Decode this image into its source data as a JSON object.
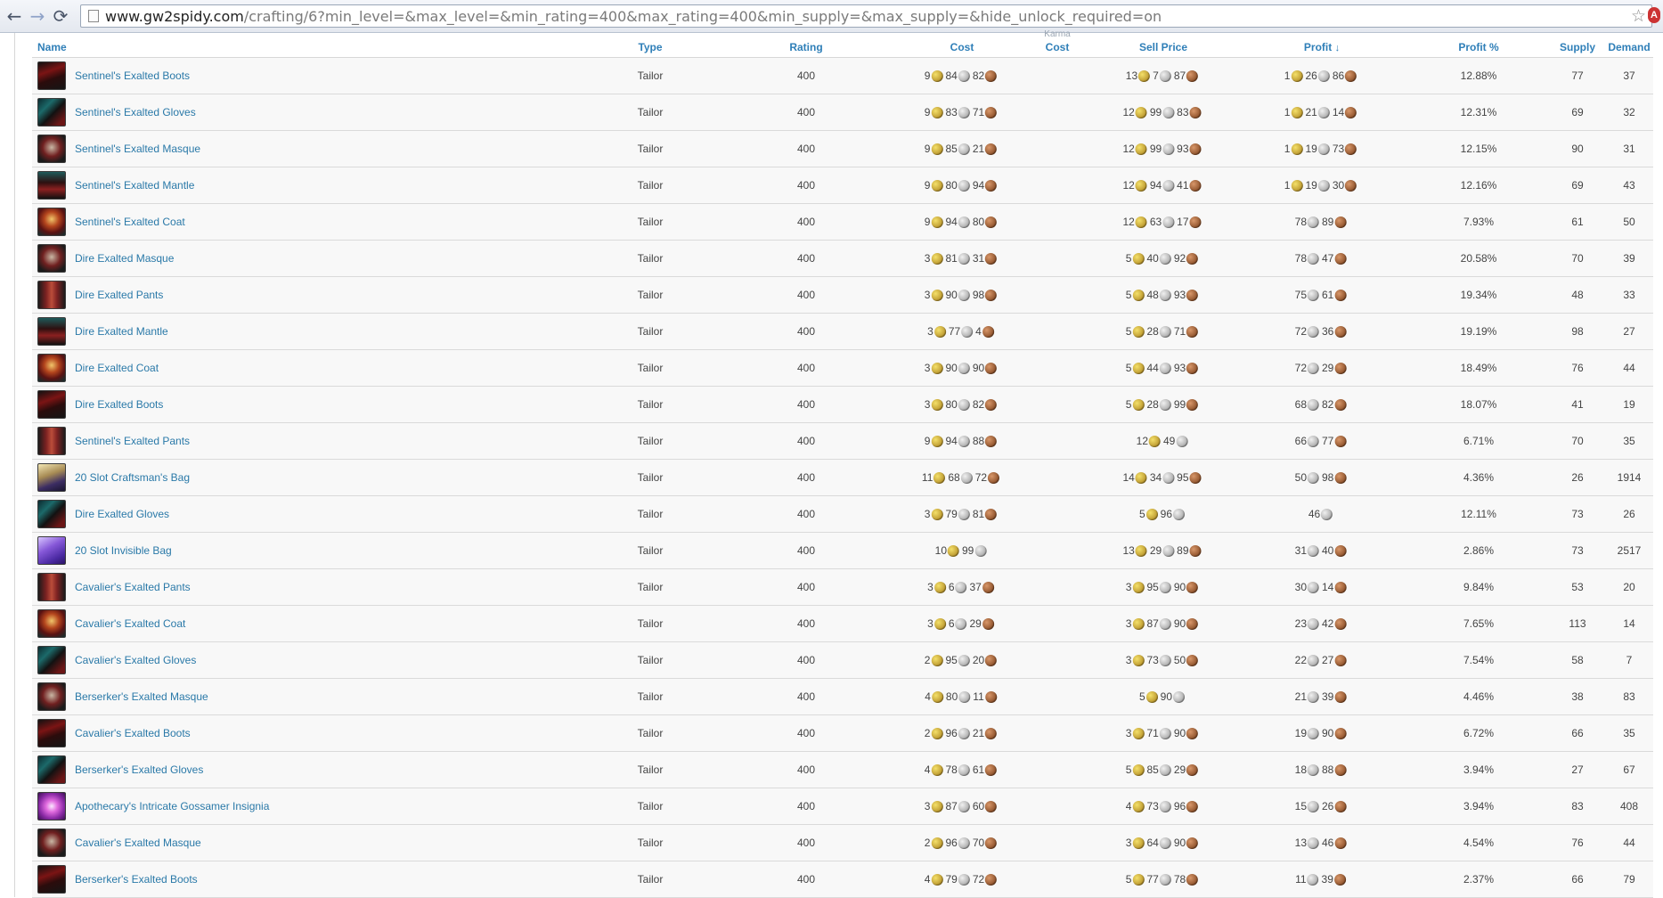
{
  "browser": {
    "back_glyph": "←",
    "forward_glyph": "→",
    "reload_glyph": "⟳",
    "url_domain": "www.gw2spidy.com",
    "url_rest": "/crafting/6?min_level=&max_level=&min_rating=400&max_rating=400&min_supply=&max_supply=&hide_unlock_required=on",
    "star_glyph": "☆",
    "extension_label": "A"
  },
  "table": {
    "headers": {
      "name": "Name",
      "type": "Type",
      "rating": "Rating",
      "cost": "Cost",
      "karma_top": "Karma",
      "karma_cost": "Cost",
      "sell_price": "Sell Price",
      "profit": "Profit",
      "profit_sort_arrow": "↓",
      "profit_pct": "Profit %",
      "supply": "Supply",
      "demand": "Demand"
    },
    "rows": [
      {
        "name": "Sentinel's Exalted Boots",
        "icon": "boots",
        "type": "Tailor",
        "rating": "400",
        "cost": [
          "9",
          "84",
          "82"
        ],
        "sell": [
          "13",
          "7",
          "87"
        ],
        "profit": [
          "1",
          "26",
          "86"
        ],
        "profit_pct": "12.88%",
        "supply": "77",
        "demand": "37"
      },
      {
        "name": "Sentinel's Exalted Gloves",
        "icon": "gloves",
        "type": "Tailor",
        "rating": "400",
        "cost": [
          "9",
          "83",
          "71"
        ],
        "sell": [
          "12",
          "99",
          "83"
        ],
        "profit": [
          "1",
          "21",
          "14"
        ],
        "profit_pct": "12.31%",
        "supply": "69",
        "demand": "32"
      },
      {
        "name": "Sentinel's Exalted Masque",
        "icon": "masque",
        "type": "Tailor",
        "rating": "400",
        "cost": [
          "9",
          "85",
          "21"
        ],
        "sell": [
          "12",
          "99",
          "93"
        ],
        "profit": [
          "1",
          "19",
          "73"
        ],
        "profit_pct": "12.15%",
        "supply": "90",
        "demand": "31"
      },
      {
        "name": "Sentinel's Exalted Mantle",
        "icon": "mantle",
        "type": "Tailor",
        "rating": "400",
        "cost": [
          "9",
          "80",
          "94"
        ],
        "sell": [
          "12",
          "94",
          "41"
        ],
        "profit": [
          "1",
          "19",
          "30"
        ],
        "profit_pct": "12.16%",
        "supply": "69",
        "demand": "43"
      },
      {
        "name": "Sentinel's Exalted Coat",
        "icon": "coat",
        "type": "Tailor",
        "rating": "400",
        "cost": [
          "9",
          "94",
          "80"
        ],
        "sell": [
          "12",
          "63",
          "17"
        ],
        "profit": [
          "",
          "78",
          "89"
        ],
        "profit_pct": "7.93%",
        "supply": "61",
        "demand": "50"
      },
      {
        "name": "Dire Exalted Masque",
        "icon": "masque",
        "type": "Tailor",
        "rating": "400",
        "cost": [
          "3",
          "81",
          "31"
        ],
        "sell": [
          "5",
          "40",
          "92"
        ],
        "profit": [
          "",
          "78",
          "47"
        ],
        "profit_pct": "20.58%",
        "supply": "70",
        "demand": "39"
      },
      {
        "name": "Dire Exalted Pants",
        "icon": "pants",
        "type": "Tailor",
        "rating": "400",
        "cost": [
          "3",
          "90",
          "98"
        ],
        "sell": [
          "5",
          "48",
          "93"
        ],
        "profit": [
          "",
          "75",
          "61"
        ],
        "profit_pct": "19.34%",
        "supply": "48",
        "demand": "33"
      },
      {
        "name": "Dire Exalted Mantle",
        "icon": "mantle",
        "type": "Tailor",
        "rating": "400",
        "cost": [
          "3",
          "77",
          "4"
        ],
        "sell": [
          "5",
          "28",
          "71"
        ],
        "profit": [
          "",
          "72",
          "36"
        ],
        "profit_pct": "19.19%",
        "supply": "98",
        "demand": "27"
      },
      {
        "name": "Dire Exalted Coat",
        "icon": "coat",
        "type": "Tailor",
        "rating": "400",
        "cost": [
          "3",
          "90",
          "90"
        ],
        "sell": [
          "5",
          "44",
          "93"
        ],
        "profit": [
          "",
          "72",
          "29"
        ],
        "profit_pct": "18.49%",
        "supply": "76",
        "demand": "44"
      },
      {
        "name": "Dire Exalted Boots",
        "icon": "boots",
        "type": "Tailor",
        "rating": "400",
        "cost": [
          "3",
          "80",
          "82"
        ],
        "sell": [
          "5",
          "28",
          "99"
        ],
        "profit": [
          "",
          "68",
          "82"
        ],
        "profit_pct": "18.07%",
        "supply": "41",
        "demand": "19"
      },
      {
        "name": "Sentinel's Exalted Pants",
        "icon": "pants",
        "type": "Tailor",
        "rating": "400",
        "cost": [
          "9",
          "94",
          "88"
        ],
        "sell": [
          "12",
          "49",
          ""
        ],
        "profit": [
          "",
          "66",
          "77"
        ],
        "profit_pct": "6.71%",
        "supply": "70",
        "demand": "35"
      },
      {
        "name": "20 Slot Craftsman's Bag",
        "icon": "bag",
        "type": "Tailor",
        "rating": "400",
        "cost": [
          "11",
          "68",
          "72"
        ],
        "sell": [
          "14",
          "34",
          "95"
        ],
        "profit": [
          "",
          "50",
          "98"
        ],
        "profit_pct": "4.36%",
        "supply": "26",
        "demand": "1914"
      },
      {
        "name": "Dire Exalted Gloves",
        "icon": "gloves",
        "type": "Tailor",
        "rating": "400",
        "cost": [
          "3",
          "79",
          "81"
        ],
        "sell": [
          "5",
          "96",
          ""
        ],
        "profit": [
          "",
          "46",
          ""
        ],
        "profit_pct": "12.11%",
        "supply": "73",
        "demand": "26"
      },
      {
        "name": "20 Slot Invisible Bag",
        "icon": "invbag",
        "type": "Tailor",
        "rating": "400",
        "cost": [
          "10",
          "99",
          ""
        ],
        "sell": [
          "13",
          "29",
          "89"
        ],
        "profit": [
          "",
          "31",
          "40"
        ],
        "profit_pct": "2.86%",
        "supply": "73",
        "demand": "2517"
      },
      {
        "name": "Cavalier's Exalted Pants",
        "icon": "pants",
        "type": "Tailor",
        "rating": "400",
        "cost": [
          "3",
          "6",
          "37"
        ],
        "sell": [
          "3",
          "95",
          "90"
        ],
        "profit": [
          "",
          "30",
          "14"
        ],
        "profit_pct": "9.84%",
        "supply": "53",
        "demand": "20"
      },
      {
        "name": "Cavalier's Exalted Coat",
        "icon": "coat",
        "type": "Tailor",
        "rating": "400",
        "cost": [
          "3",
          "6",
          "29"
        ],
        "sell": [
          "3",
          "87",
          "90"
        ],
        "profit": [
          "",
          "23",
          "42"
        ],
        "profit_pct": "7.65%",
        "supply": "113",
        "demand": "14"
      },
      {
        "name": "Cavalier's Exalted Gloves",
        "icon": "gloves",
        "type": "Tailor",
        "rating": "400",
        "cost": [
          "2",
          "95",
          "20"
        ],
        "sell": [
          "3",
          "73",
          "50"
        ],
        "profit": [
          "",
          "22",
          "27"
        ],
        "profit_pct": "7.54%",
        "supply": "58",
        "demand": "7"
      },
      {
        "name": "Berserker's Exalted Masque",
        "icon": "masque",
        "type": "Tailor",
        "rating": "400",
        "cost": [
          "4",
          "80",
          "11"
        ],
        "sell": [
          "5",
          "90",
          ""
        ],
        "profit": [
          "",
          "21",
          "39"
        ],
        "profit_pct": "4.46%",
        "supply": "38",
        "demand": "83"
      },
      {
        "name": "Cavalier's Exalted Boots",
        "icon": "boots",
        "type": "Tailor",
        "rating": "400",
        "cost": [
          "2",
          "96",
          "21"
        ],
        "sell": [
          "3",
          "71",
          "90"
        ],
        "profit": [
          "",
          "19",
          "90"
        ],
        "profit_pct": "6.72%",
        "supply": "66",
        "demand": "35"
      },
      {
        "name": "Berserker's Exalted Gloves",
        "icon": "gloves",
        "type": "Tailor",
        "rating": "400",
        "cost": [
          "4",
          "78",
          "61"
        ],
        "sell": [
          "5",
          "85",
          "29"
        ],
        "profit": [
          "",
          "18",
          "88"
        ],
        "profit_pct": "3.94%",
        "supply": "27",
        "demand": "67"
      },
      {
        "name": "Apothecary's Intricate Gossamer Insignia",
        "icon": "insignia",
        "type": "Tailor",
        "rating": "400",
        "cost": [
          "3",
          "87",
          "60"
        ],
        "sell": [
          "4",
          "73",
          "96"
        ],
        "profit": [
          "",
          "15",
          "26"
        ],
        "profit_pct": "3.94%",
        "supply": "83",
        "demand": "408"
      },
      {
        "name": "Cavalier's Exalted Masque",
        "icon": "masque",
        "type": "Tailor",
        "rating": "400",
        "cost": [
          "2",
          "96",
          "70"
        ],
        "sell": [
          "3",
          "64",
          "90"
        ],
        "profit": [
          "",
          "13",
          "46"
        ],
        "profit_pct": "4.54%",
        "supply": "76",
        "demand": "44"
      },
      {
        "name": "Berserker's Exalted Boots",
        "icon": "boots",
        "type": "Tailor",
        "rating": "400",
        "cost": [
          "4",
          "79",
          "72"
        ],
        "sell": [
          "5",
          "77",
          "78"
        ],
        "profit": [
          "",
          "11",
          "39"
        ],
        "profit_pct": "2.37%",
        "supply": "66",
        "demand": "79"
      }
    ]
  }
}
